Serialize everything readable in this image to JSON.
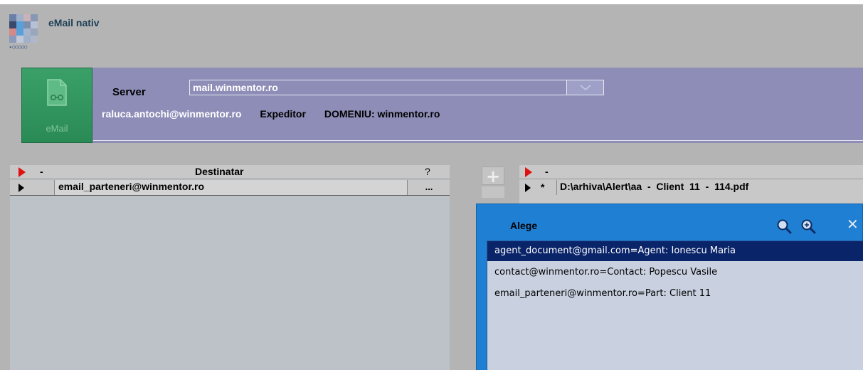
{
  "app": {
    "title": "eMail nativ",
    "dots": "▸○○○○○"
  },
  "email_bar": {
    "button_label": "eMail",
    "server_label": "Server",
    "server_value": "mail.winmentor.ro",
    "sender": "raluca.antochi@winmentor.ro",
    "sender_label": "Expeditor",
    "domain": "DOMENIU: winmentor.ro"
  },
  "recipients": {
    "marker": "-",
    "header": "Destinatar",
    "help": "?",
    "rows": [
      {
        "value": "email_parteneri@winmentor.ro",
        "button": "..."
      }
    ]
  },
  "attachments": {
    "marker": "-",
    "rows": [
      {
        "flag": "*",
        "path": "D:\\arhiva\\Alert\\aa  -  Client  11  -  114.pdf"
      }
    ]
  },
  "popup": {
    "title": "Alege",
    "items": [
      "agent_document@gmail.com=Agent: Ionescu Maria",
      "contact@winmentor.ro=Contact: Popescu Vasile",
      "email_parteneri@winmentor.ro=Part: Client 11"
    ],
    "selected_index": 0
  },
  "colors": {
    "email_bar": "#8d8db8",
    "email_button": "#2a8a55",
    "popup_bg": "#1f7fd2",
    "selection": "#0a246a",
    "marker_red": "#e01010"
  }
}
